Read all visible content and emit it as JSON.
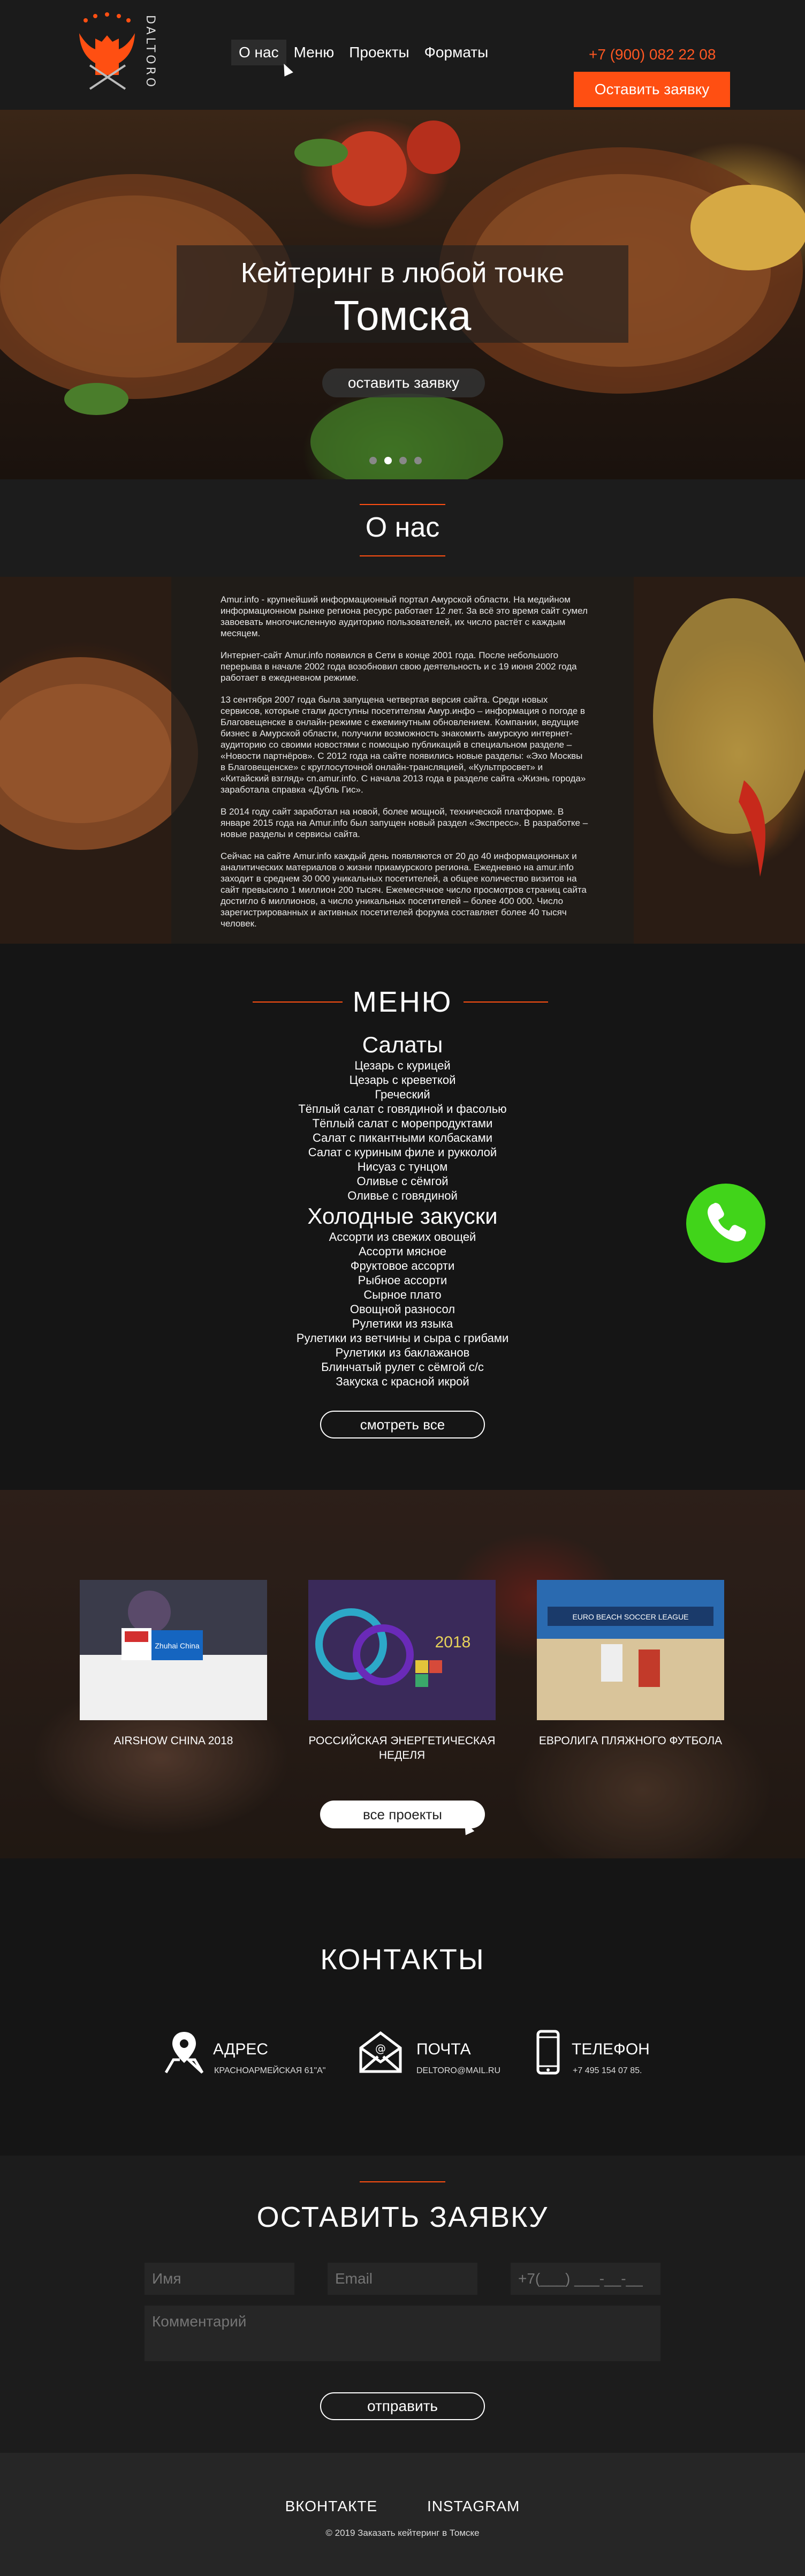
{
  "brand": {
    "name": "DALTORO",
    "accent": "#ff4f12"
  },
  "header": {
    "nav": [
      "О нас",
      "Меню",
      "Проекты",
      "Форматы"
    ],
    "phone": "+7 (900) 082 22 08",
    "order_button": "Оставить заявку"
  },
  "hero": {
    "subtitle": "Кейтеринг в любой точке",
    "title": "Томска",
    "button": "оставить заявку",
    "slides_total": 4,
    "active_slide": 2
  },
  "about": {
    "title": "О нас",
    "paragraphs": [
      "Amur.info - крупнейший информационный портал Амурской области. На медийном информационном рынке региона ресурс работает 12 лет. За всё это время сайт сумел завоевать многочисленную аудиторию пользователей, их число растёт с каждым месяцем.",
      "Интернет-сайт Amur.info появился в Сети в конце 2001 года. После небольшого перерыва в начале 2002 года возобновил свою деятельность и с 19 июня 2002 года работает в ежедневном режиме.",
      "13 сентября 2007 года была запущена четвертая версия сайта. Среди новых сервисов, которые стали доступны посетителям Амур.инфо – информация о погоде в Благовещенске в онлайн-режиме с ежеминутным обновлением. Компании, ведущие бизнес в Амурской области, получили возможность знакомить амурскую интернет-аудиторию со своими новостями с помощью публикаций в специальном разделе – «Новости партнёров». С 2012 года на сайте появились новые разделы: «Эхо Москвы в Благовещенске» с круглосуточной онлайн-трансляцией, «Культпросвет» и «Китайский взгляд» cn.amur.info. С начала 2013 года в разделе сайта «Жизнь города» заработала справка «Дубль Гис».",
      "В 2014 году сайт заработал на новой, более мощной, технической платформе. В январе 2015 года на Amur.info был запущен новый раздел «Экспресс». В разработке – новые разделы и сервисы сайта.",
      "Сейчас на сайте Amur.info каждый день появляются от 20 до 40 информационных и аналитических материалов о жизни приамурского региона. Ежедневно на amur.info заходит в среднем 30 000 уникальных посетителей, а общее количество визитов на сайт превысило 1 миллион 200 тысяч. Ежемесячное число просмотров страниц сайта достигло 6 миллионов, а число уникальных посетителей – более 400 000. Число зарегистрированных и активных посетителей форума составляет более 40 тысяч человек."
    ]
  },
  "menu": {
    "title": "МЕНЮ",
    "categories": [
      {
        "name": "Салаты",
        "items": [
          "Цезарь с курицей",
          "Цезарь с креветкой",
          "Греческий",
          "Тёплый салат с говядиной и фасолью",
          "Тёплый салат с морепродуктами",
          "Салат с пикантными колбасками",
          "Салат с куриным филе и рукколой",
          "Нисуаз с тунцом",
          "Оливье с сёмгой",
          "Оливье с говядиной"
        ]
      },
      {
        "name": "Холодные закуски",
        "items": [
          "Ассорти из свежих овощей",
          "Ассорти мясное",
          "Фруктовое ассорти",
          "Рыбное ассорти",
          "Сырное плато",
          "Овощной разносол",
          "Рулетики из языка",
          "Рулетики из ветчины и сыра с грибами",
          "Рулетики из баклажанов",
          "Блинчатый рулет с сёмгой с/с",
          "Закуска с красной икрой"
        ]
      }
    ],
    "button": "смотреть все"
  },
  "projects": {
    "cards": [
      {
        "caption": "AIRSHOW CHINA 2018",
        "image_label": "Zhuhai China"
      },
      {
        "caption": "РОССИЙСКАЯ ЭНЕРГЕТИЧЕСКАЯ НЕДЕЛЯ",
        "image_label": "2018"
      },
      {
        "caption": "ЕВРОЛИГА ПЛЯЖНОГО ФУТБОЛА",
        "image_label": "EURO BEACH SOCCER LEAGUE"
      }
    ],
    "button": "все проекты"
  },
  "contacts": {
    "title": "КОНТАКТЫ",
    "items": [
      {
        "label": "АДРЕС",
        "value": "КРАСНОАРМЕЙСКАЯ 61\"А\"",
        "icon": "map-pin-icon"
      },
      {
        "label": "ПОЧТА",
        "value": "DELTORO@MAIL.RU",
        "icon": "mail-icon"
      },
      {
        "label": "ТЕЛЕФОН",
        "value": "+7 495 154 07 85.",
        "icon": "smartphone-icon"
      }
    ]
  },
  "form": {
    "title": "ОСТАВИТЬ ЗАЯВКУ",
    "name_placeholder": "Имя",
    "email_placeholder": "Email",
    "phone_placeholder": "+7(___) ___-__-__",
    "comment_placeholder": "Комментарий",
    "submit": "отправить"
  },
  "footer": {
    "links": [
      "ВКОНТАКТЕ",
      "INSTAGRAM"
    ],
    "copyright": "© 2019 Заказать кейтеринг в Томске"
  }
}
